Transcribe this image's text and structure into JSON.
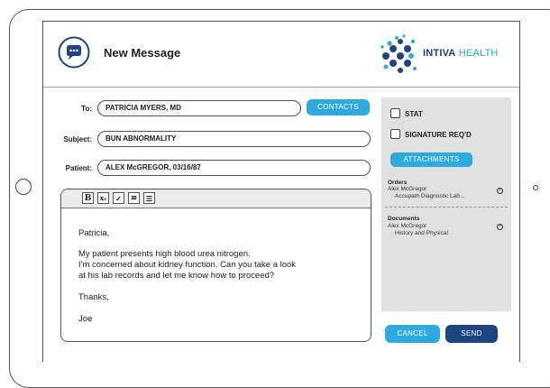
{
  "header": {
    "title": "New Message",
    "brand_primary": "INTIVA",
    "brand_secondary": "HEALTH",
    "icon": "chat-bubble-icon"
  },
  "form": {
    "to_label": "To:",
    "to_value": "PATRICIA MYERS, MD",
    "contacts_label": "CONTACTS",
    "subject_label": "Subject:",
    "subject_value": "BUN ABNORMALITY",
    "patient_label": "Patient:",
    "patient_value": "ALEX McGREGOR, 03/16/87"
  },
  "toolbar": {
    "bold": "B",
    "subscript": "x₂",
    "brush": "✓",
    "align": "≡",
    "list": "☰"
  },
  "message": {
    "lines": [
      "Patricia,",
      "My patient presents high blood urea nitrogen.",
      "I'm concerned about kidney function. Can you take a look",
      "at his lab records and let me know how to proceed?",
      "Thanks,",
      "Joe"
    ]
  },
  "options": {
    "stat_label": "STAT",
    "signature_label": "SIGNATURE REQ'D",
    "attachments_label": "ATTACHMENTS"
  },
  "attachments": {
    "orders_title": "Orders",
    "orders_name": "Alex McGregor",
    "orders_item": "Accupath Diagnostic Lab...",
    "documents_title": "Documents",
    "documents_name": "Alex McGregor",
    "documents_item": "History and Physical"
  },
  "actions": {
    "cancel_label": "CANCEL",
    "send_label": "SEND"
  },
  "colors": {
    "accent_blue": "#2eaadf",
    "navy": "#1d4380"
  }
}
